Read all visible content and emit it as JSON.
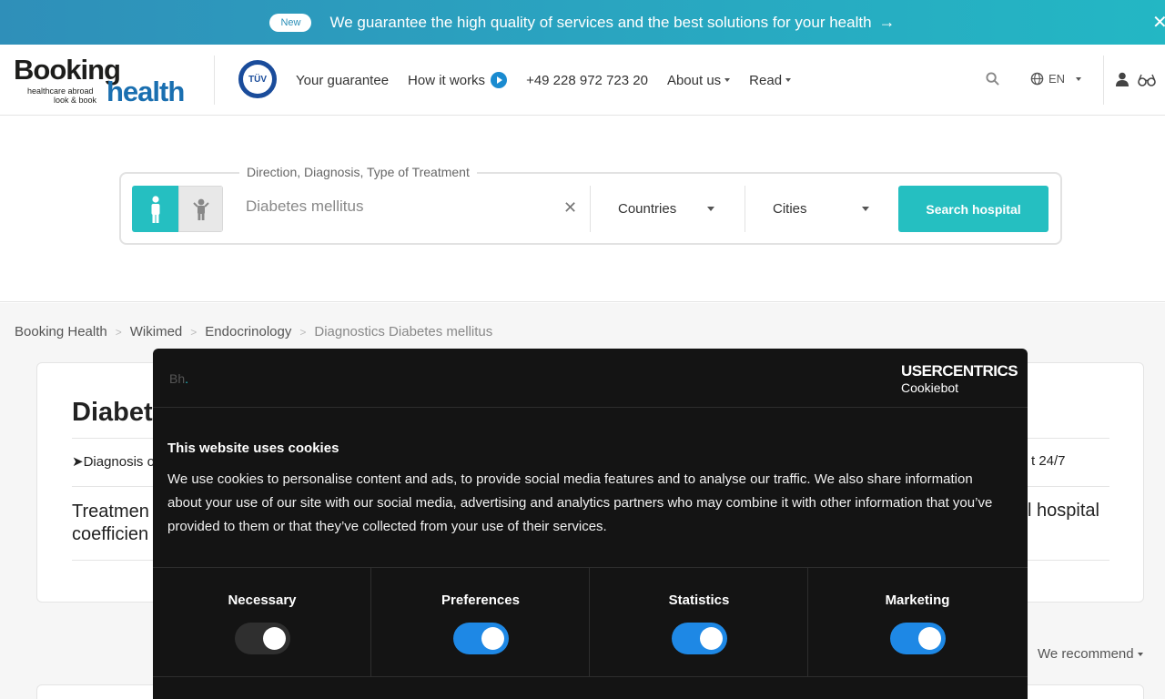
{
  "banner": {
    "badge": "New",
    "text": "We guarantee the high quality of services and the best solutions for your health",
    "accent": "#25bfc1"
  },
  "header": {
    "logo_booking": "Booking",
    "logo_tag1": "healthcare abroad",
    "logo_tag2": "look & book",
    "logo_health": "health",
    "tuv": "TÜV",
    "nav": {
      "guarantee": "Your guarantee",
      "how_it_works": "How it works",
      "phone": "+49 228 972 723 20",
      "about": "About us",
      "read": "Read"
    },
    "lang": "EN"
  },
  "search": {
    "legend": "Direction, Diagnosis, Type of Treatment",
    "diagnosis_value": "Diabetes mellitus",
    "countries": "Countries",
    "cities": "Cities",
    "button": "Search hospital"
  },
  "breadcrumb": {
    "items": [
      "Booking Health",
      "Wikimed",
      "Endocrinology"
    ],
    "current": "Diagnostics Diabetes mellitus"
  },
  "content": {
    "title": "Diabet",
    "diag_link": "➤Diagnosis o",
    "available": "t 24/7",
    "treat_line1": "Treatmen",
    "treat_line2": "coefficien",
    "hospital": "l hospital",
    "sort_colon": ":",
    "sort_value": "We recommend"
  },
  "cookie": {
    "logo_b": "Bh",
    "logo_dot": ".",
    "brand": "USERCENTRICS",
    "brand_sub": "Cookiebot",
    "title": "This website uses cookies",
    "body": "We use cookies to personalise content and ads, to provide social media features and to analyse our traffic. We also share information about your use of our site with our social media, advertising and analytics partners who may combine it with other information that you’ve provided to them or that they’ve collected from your use of their services.",
    "categories": [
      {
        "label": "Necessary",
        "enabled": true,
        "locked": true
      },
      {
        "label": "Preferences",
        "enabled": true
      },
      {
        "label": "Statistics",
        "enabled": true
      },
      {
        "label": "Marketing",
        "enabled": true
      }
    ],
    "toggle_color": "#1e88e5"
  }
}
